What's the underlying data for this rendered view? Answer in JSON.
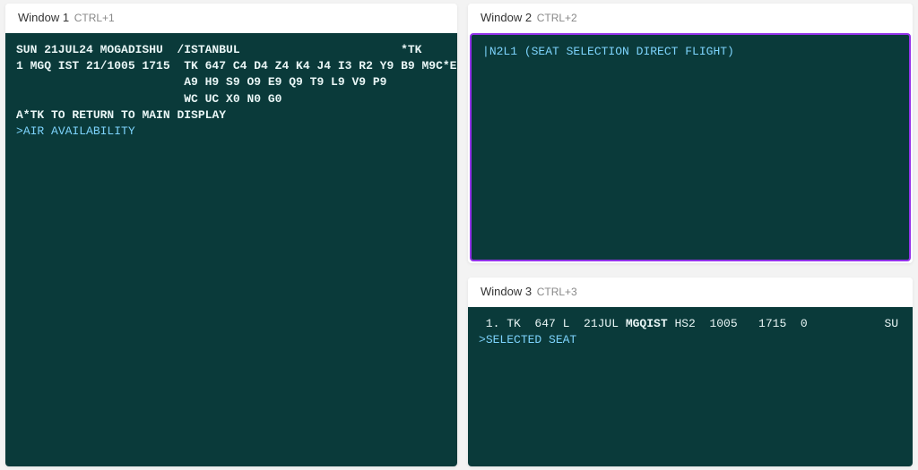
{
  "window1": {
    "title": "Window 1",
    "shortcut": "CTRL+1",
    "line1": "SUN 21JUL24 MOGADISHU  /ISTANBUL                       *TK",
    "line2": "1 MGQ IST 21/1005 1715  TK 647 C4 D4 Z4 K4 J4 I3 R2 Y9 B9 M9C*E",
    "line3": "                        A9 H9 S9 O9 E9 Q9 T9 L9 V9 P9",
    "line4": "                        WC UC X0 N0 G0",
    "line5_pre": "A*TK TO ",
    "line5_bold": "RETURN",
    "line5_post": " TO MAIN DISPLAY",
    "cmd_prefix": ">",
    "cmd_text": "AIR AVAILABILITY"
  },
  "window2": {
    "title": "Window 2",
    "shortcut": "CTRL+2",
    "cursor_char": "|",
    "input_text": "N2L1 (SEAT SELECTION DIRECT FLIGHT)"
  },
  "window3": {
    "title": "Window 3",
    "shortcut": "CTRL+3",
    "line1_a": " 1. TK  647 L  21JUL ",
    "line1_bold": "MGQIST",
    "line1_b": " HS2  1005   1715  0           SU",
    "cmd_prefix": ">",
    "cmd_text": "SELECTED SEAT"
  }
}
